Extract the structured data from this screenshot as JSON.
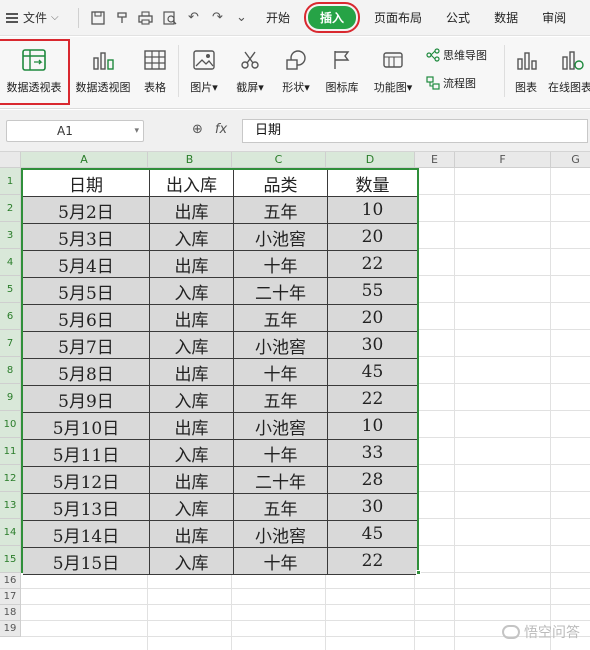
{
  "menubar": {
    "file_label": "文件",
    "tabs": [
      "开始",
      "插入",
      "页面布局",
      "公式",
      "数据",
      "审阅"
    ],
    "active_tab": "插入"
  },
  "ribbon": {
    "pivot_table": "数据透视表",
    "pivot_chart": "数据透视图",
    "table": "表格",
    "picture": "图片",
    "screenshot": "截屏",
    "shape": "形状",
    "icon_library": "图标库",
    "function_chart": "功能图",
    "mind_map": "思维导图",
    "flowchart": "流程图",
    "chart": "图表",
    "online_chart": "在线图表"
  },
  "formula_bar": {
    "cell_ref": "A1",
    "fx": "fx",
    "content": "日期"
  },
  "columns": [
    "A",
    "B",
    "C",
    "D",
    "E",
    "F",
    "G"
  ],
  "rows": [
    "1",
    "2",
    "3",
    "4",
    "5",
    "6",
    "7",
    "8",
    "9",
    "10",
    "11",
    "12",
    "13",
    "14",
    "15",
    "16",
    "17",
    "18",
    "19"
  ],
  "table": {
    "headers": [
      "日期",
      "出入库",
      "品类",
      "数量"
    ],
    "data": [
      [
        "5月2日",
        "出库",
        "五年",
        "10"
      ],
      [
        "5月3日",
        "入库",
        "小池窖",
        "20"
      ],
      [
        "5月4日",
        "出库",
        "十年",
        "22"
      ],
      [
        "5月5日",
        "入库",
        "二十年",
        "55"
      ],
      [
        "5月6日",
        "出库",
        "五年",
        "20"
      ],
      [
        "5月7日",
        "入库",
        "小池窖",
        "30"
      ],
      [
        "5月8日",
        "出库",
        "十年",
        "45"
      ],
      [
        "5月9日",
        "入库",
        "五年",
        "22"
      ],
      [
        "5月10日",
        "出库",
        "小池窖",
        "10"
      ],
      [
        "5月11日",
        "入库",
        "十年",
        "33"
      ],
      [
        "5月12日",
        "出库",
        "二十年",
        "28"
      ],
      [
        "5月13日",
        "入库",
        "五年",
        "30"
      ],
      [
        "5月14日",
        "出库",
        "小池窖",
        "45"
      ],
      [
        "5月15日",
        "入库",
        "十年",
        "22"
      ]
    ]
  },
  "watermark": "悟空问答",
  "colors": {
    "accent": "#26a346",
    "highlight": "#d9282f",
    "selection": "#2f8f3a"
  }
}
